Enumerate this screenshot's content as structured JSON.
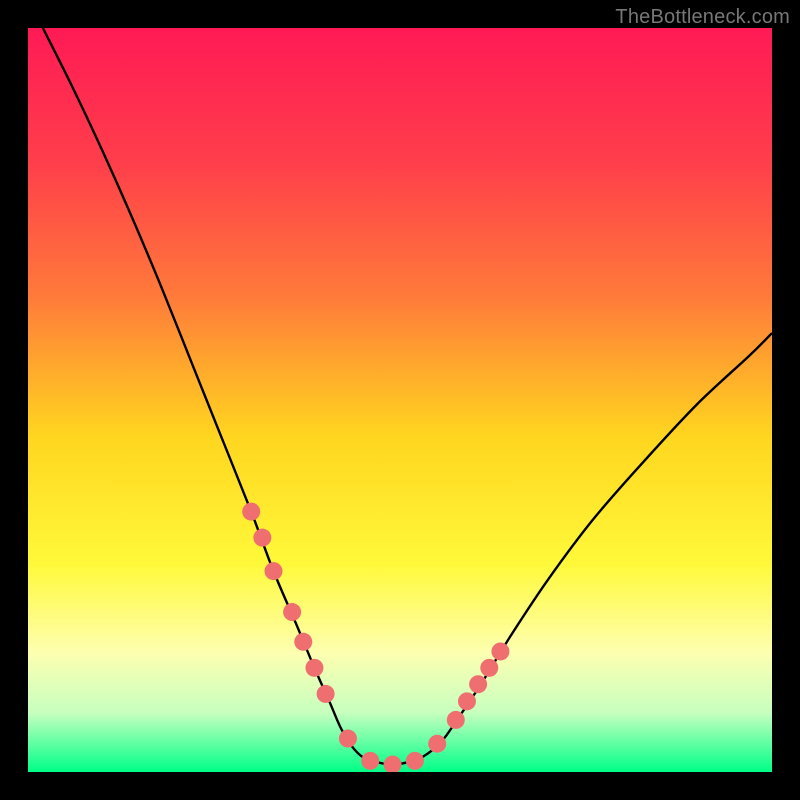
{
  "watermark": "TheBottleneck.com",
  "chart_data": {
    "type": "line",
    "title": "",
    "xlabel": "",
    "ylabel": "",
    "xlim": [
      0,
      100
    ],
    "ylim": [
      0,
      100
    ],
    "grid": false,
    "legend": false,
    "background_gradient": {
      "type": "vertical",
      "stops": [
        {
          "offset": 0.0,
          "color": "#ff1a55"
        },
        {
          "offset": 0.18,
          "color": "#ff3e4b"
        },
        {
          "offset": 0.36,
          "color": "#ff7a3a"
        },
        {
          "offset": 0.55,
          "color": "#ffd61f"
        },
        {
          "offset": 0.72,
          "color": "#fff93a"
        },
        {
          "offset": 0.84,
          "color": "#fdffb0"
        },
        {
          "offset": 0.92,
          "color": "#c7ffbf"
        },
        {
          "offset": 1.0,
          "color": "#00ff88"
        }
      ]
    },
    "series": [
      {
        "name": "bottleneck-curve",
        "type": "line",
        "color": "#000000",
        "x": [
          2,
          6,
          10,
          14,
          18,
          22,
          26,
          30,
          33,
          36,
          38.5,
          40.5,
          42,
          43.5,
          45,
          47,
          49,
          51,
          53,
          55.5,
          58,
          61,
          65,
          70,
          76,
          83,
          90,
          97,
          100
        ],
        "y": [
          100,
          92,
          83.5,
          74.5,
          65,
          55,
          45,
          35,
          27,
          20,
          14,
          9.5,
          6,
          3.5,
          2,
          1.3,
          1,
          1.3,
          2,
          4,
          7.5,
          12,
          18.5,
          26,
          34,
          42,
          49.5,
          56,
          59
        ]
      },
      {
        "name": "highlight-points",
        "type": "scatter",
        "color": "#ef6f70",
        "x": [
          30,
          31.5,
          33,
          35.5,
          37,
          38.5,
          40,
          43,
          46,
          49,
          52,
          55,
          57.5,
          59,
          60.5,
          62,
          63.5
        ],
        "y": [
          35,
          31.5,
          27,
          21.5,
          17.5,
          14,
          10.5,
          4.5,
          1.5,
          1,
          1.5,
          3.8,
          7,
          9.5,
          11.8,
          14,
          16.2
        ]
      }
    ]
  }
}
